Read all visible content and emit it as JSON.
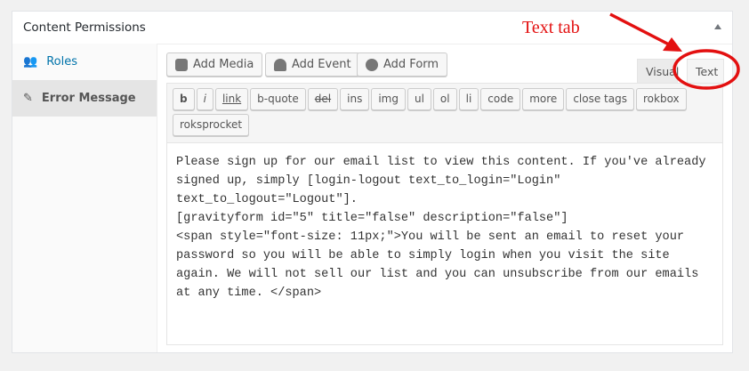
{
  "panel": {
    "title": "Content Permissions"
  },
  "sidebar": {
    "items": [
      {
        "label": "Roles"
      },
      {
        "label": "Error Message"
      }
    ]
  },
  "media_buttons": [
    {
      "label": "Add Media"
    },
    {
      "label": "Add Event"
    },
    {
      "label": "Add Form"
    }
  ],
  "editor_tabs": {
    "visual": "Visual",
    "text": "Text"
  },
  "quicktags": [
    "b",
    "i",
    "link",
    "b-quote",
    "del",
    "ins",
    "img",
    "ul",
    "ol",
    "li",
    "code",
    "more",
    "close tags",
    "rokbox",
    "roksprocket"
  ],
  "content": "Please sign up for our email list to view this content. If you've already signed up, simply [login-logout text_to_login=\"Login\" text_to_logout=\"Logout\"].\n[gravityform id=\"5\" title=\"false\" description=\"false\"]\n<span style=\"font-size: 11px;\">You will be sent an email to reset your password so you will be able to simply login when you visit the site again. We will not sell our list and you can unsubscribe from our emails at any time. </span>",
  "annotation": {
    "label": "Text tab",
    "color": "#e31010"
  }
}
